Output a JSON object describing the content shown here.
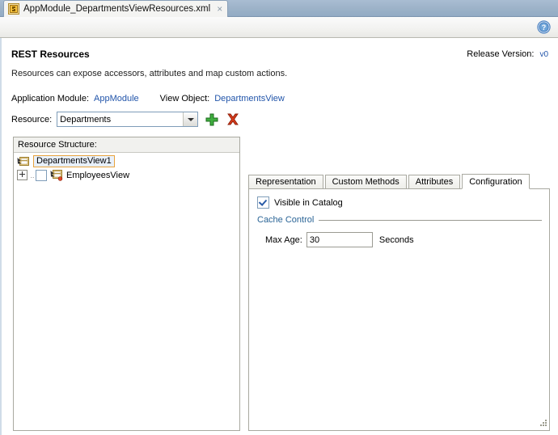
{
  "editor_tab": {
    "label": "AppModule_DepartmentsViewResources.xml",
    "close": "×",
    "icon": "xml-file-icon"
  },
  "toolbar": {
    "help_icon": "help-circle-icon"
  },
  "header": {
    "title": "REST Resources",
    "subtitle": "Resources can expose accessors, attributes and map custom actions.",
    "release_label": "Release Version:",
    "release_value": "v0"
  },
  "info": {
    "app_module_label": "Application Module:",
    "app_module_value": "AppModule",
    "view_object_label": "View Object:",
    "view_object_value": "DepartmentsView"
  },
  "resource": {
    "label": "Resource:",
    "selected": "Departments",
    "options": [
      "Departments"
    ],
    "add_icon": "plus-icon",
    "delete_icon": "delete-x-icon"
  },
  "structure": {
    "header": "Resource Structure:",
    "nodes": [
      {
        "label": "DepartmentsView1",
        "selected": true,
        "has_expander": false,
        "has_checkbox": false,
        "icon": "view-object-icon"
      },
      {
        "label": "EmployeesView",
        "selected": false,
        "has_expander": true,
        "has_checkbox": true,
        "checked": false,
        "expander": "+",
        "icon": "view-object-accessor-icon"
      }
    ]
  },
  "detail": {
    "tabs": [
      {
        "label": "Representation",
        "active": false
      },
      {
        "label": "Custom Methods",
        "active": false
      },
      {
        "label": "Attributes",
        "active": false
      },
      {
        "label": "Configuration",
        "active": true
      }
    ],
    "visible_in_catalog": {
      "label": "Visible in Catalog",
      "checked": true
    },
    "cache_control": {
      "group_label": "Cache Control",
      "max_age_label": "Max Age:",
      "max_age_value": "30",
      "max_age_units": "Seconds"
    }
  },
  "colors": {
    "tabstrip": "#9cb2c8",
    "link": "#2255aa",
    "group_label": "#2a6496",
    "selection_border": "#e8a33d",
    "add": "#3aa63a",
    "delete": "#cc2200"
  }
}
